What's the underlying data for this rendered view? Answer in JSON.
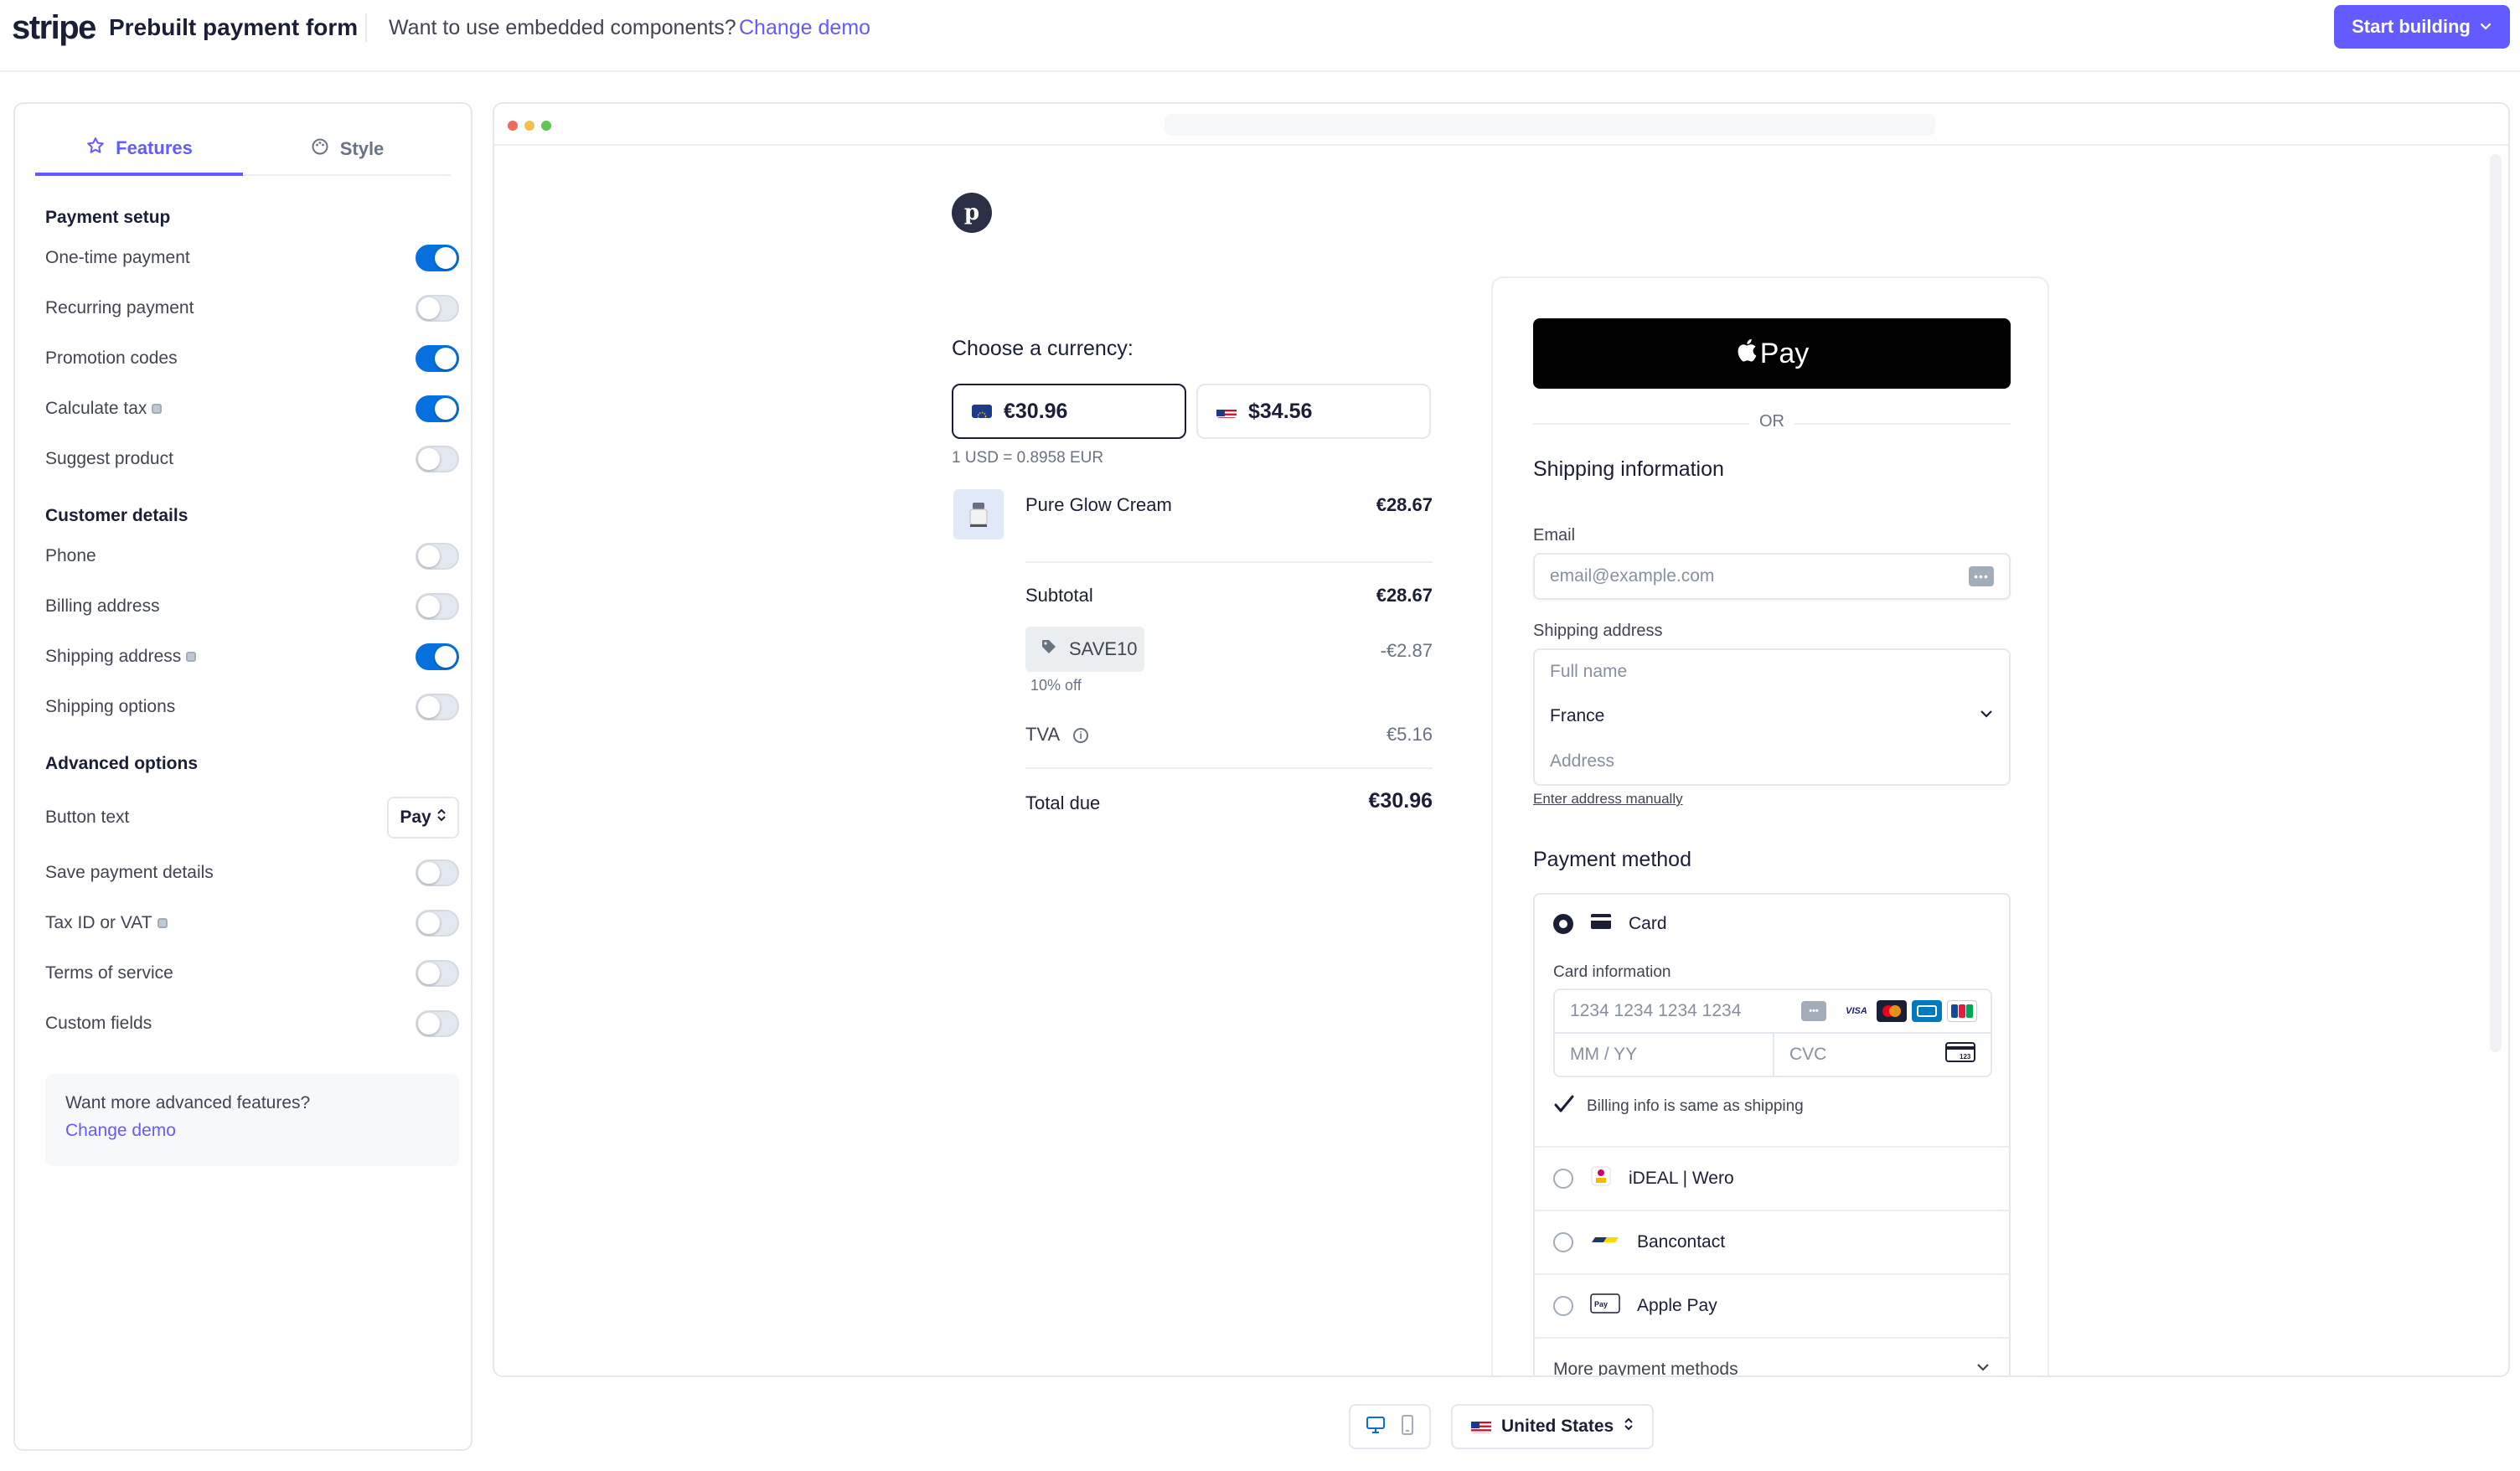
{
  "header": {
    "logo": "stripe",
    "title": "Prebuilt payment form",
    "embedded_prompt": "Want to use embedded components?",
    "change_demo": "Change demo",
    "start_building": "Start building"
  },
  "sidebar": {
    "tabs": [
      {
        "label": "Features",
        "active": true,
        "icon": "star-icon"
      },
      {
        "label": "Style",
        "active": false,
        "icon": "palette-icon"
      }
    ],
    "payment_setup": {
      "heading": "Payment setup",
      "options": [
        {
          "label": "One-time payment",
          "enabled": true
        },
        {
          "label": "Recurring payment",
          "enabled": false
        },
        {
          "label": "Promotion codes",
          "enabled": true
        },
        {
          "label": "Calculate tax",
          "enabled": true,
          "info": true
        },
        {
          "label": "Suggest product",
          "enabled": false
        }
      ]
    },
    "customer_details": {
      "heading": "Customer details",
      "options": [
        {
          "label": "Phone",
          "enabled": false
        },
        {
          "label": "Billing address",
          "enabled": false
        },
        {
          "label": "Shipping address",
          "enabled": true,
          "info": true
        },
        {
          "label": "Shipping options",
          "enabled": false
        }
      ]
    },
    "advanced_options": {
      "heading": "Advanced options",
      "button_text_label": "Button text",
      "button_text_value": "Pay",
      "options": [
        {
          "label": "Save payment details",
          "enabled": false
        },
        {
          "label": "Tax ID or VAT",
          "enabled": false,
          "info": true
        },
        {
          "label": "Terms of service",
          "enabled": false
        },
        {
          "label": "Custom fields",
          "enabled": false
        }
      ]
    },
    "advanced_box": {
      "text": "Want more advanced features?",
      "link": "Change demo"
    }
  },
  "order": {
    "merchant_initial": "p",
    "currency_label": "Choose a currency:",
    "currencies": [
      {
        "amount": "€30.96",
        "flag": "eu-flag",
        "selected": true
      },
      {
        "amount": "$34.56",
        "flag": "us-flag",
        "selected": false
      }
    ],
    "rate": "1 USD = 0.8958 EUR",
    "product": {
      "name": "Pure Glow Cream",
      "price": "€28.67"
    },
    "subtotal_label": "Subtotal",
    "subtotal": "€28.67",
    "promo_code": "SAVE10",
    "promo_discount": "-€2.87",
    "promo_note": "10% off",
    "tax_label": "TVA",
    "tax": "€5.16",
    "total_label": "Total due",
    "total": "€30.96"
  },
  "checkout": {
    "apple_pay_label": "Pay",
    "or": "OR",
    "shipping_heading": "Shipping information",
    "email_label": "Email",
    "email_placeholder": "email@example.com",
    "shipping_address_label": "Shipping address",
    "fullname_placeholder": "Full name",
    "country": "France",
    "address_placeholder": "Address",
    "manual_link": "Enter address manually",
    "payment_heading": "Payment method",
    "card_label": "Card",
    "card_info_label": "Card information",
    "card_number_placeholder": "1234 1234 1234 1234",
    "expiry_placeholder": "MM / YY",
    "cvc_placeholder": "CVC",
    "billing_same": "Billing info is same as shipping",
    "methods": [
      {
        "label": "iDEAL | Wero",
        "icon": "ideal-icon"
      },
      {
        "label": "Bancontact",
        "icon": "bancontact-icon"
      },
      {
        "label": "Apple Pay",
        "icon": "apple-pay-icon"
      }
    ],
    "more_methods": "More payment methods"
  },
  "footer": {
    "country": "United States"
  },
  "colors": {
    "accent": "#635bff",
    "toggle_on": "#0570de",
    "text": "#1a1f36"
  }
}
